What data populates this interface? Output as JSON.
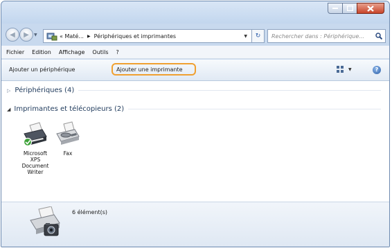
{
  "address": {
    "crumb_root": "« Maté...",
    "crumb_current": "Périphériques et imprimantes"
  },
  "search": {
    "placeholder": "Rechercher dans : Périphérique..."
  },
  "menu": [
    "Fichier",
    "Edition",
    "Affichage",
    "Outils",
    "?"
  ],
  "toolbar": {
    "add_device": "Ajouter un périphérique",
    "add_printer": "Ajouter une imprimante"
  },
  "groups": {
    "devices": "Périphériques (4)",
    "printers": "Imprimantes et télécopieurs (2)"
  },
  "printers": [
    {
      "label_lines": [
        "Microsoft",
        "XPS",
        "Document",
        "Writer"
      ]
    },
    {
      "label_lines": [
        "Fax"
      ]
    }
  ],
  "details": {
    "count": "6 élément(s)"
  }
}
